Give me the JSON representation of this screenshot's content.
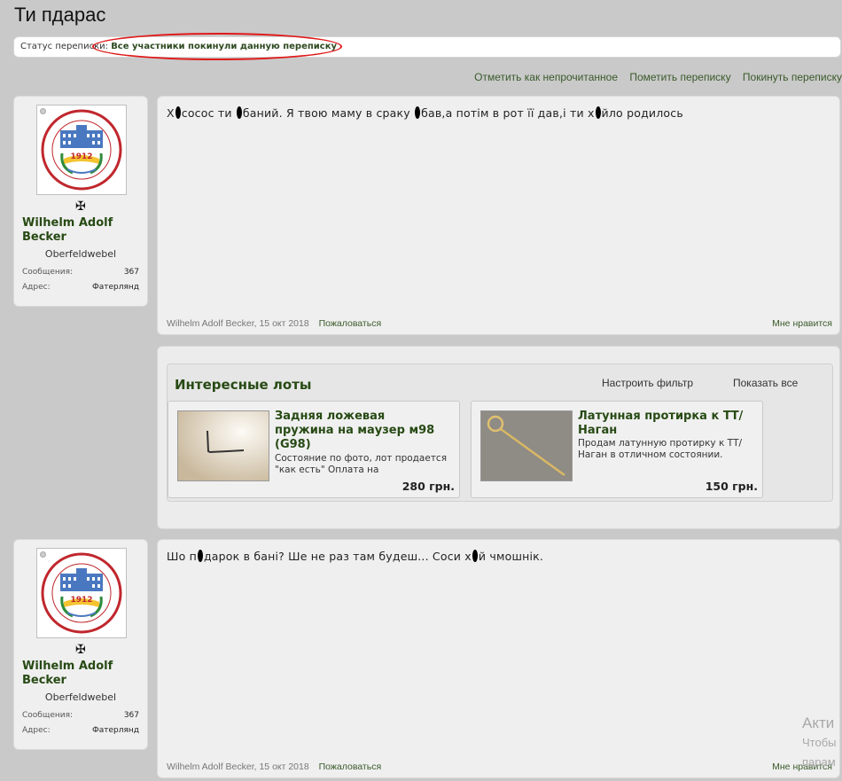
{
  "page": {
    "title": "Ти п◖дарас"
  },
  "status": {
    "label": "Статус переписки:",
    "value": "Все участники покинули данную переписку"
  },
  "conversation_actions": [
    "Отметить как непрочитанное",
    "Пометить переписку",
    "Покинуть переписку"
  ],
  "posts": [
    {
      "user": {
        "name": "Wilhelm Adolf Becker",
        "rank": "Oberfeldwebel",
        "rank_icon": "✠",
        "stats": [
          {
            "label": "Сообщения:",
            "value": "367"
          },
          {
            "label": "Адрес:",
            "value": "Фатерлянд"
          }
        ]
      },
      "text": "Х◖сосос ти ◖баний. Я твою маму в сраку ◖бав,а потім в рот її дав,і ти х◖йло родилось",
      "author": "Wilhelm Adolf Becker",
      "date": "15 окт 2018",
      "report": "Пожаловаться",
      "like": "Мне нравится"
    },
    {
      "user": {
        "name": "Wilhelm Adolf Becker",
        "rank": "Oberfeldwebel",
        "rank_icon": "✠",
        "stats": [
          {
            "label": "Сообщения:",
            "value": "367"
          },
          {
            "label": "Адрес:",
            "value": "Фатерлянд"
          }
        ]
      },
      "text": "Шо п◖дарок в бані? Ше не раз там будеш... Соси х◖й чмошнік.",
      "author": "Wilhelm Adolf Becker",
      "date": "15 окт 2018",
      "report": "Пожаловаться",
      "like": "Мне нравится"
    }
  ],
  "lots": {
    "title": "Интересные лоты",
    "actions": [
      "Настроить фильтр",
      "Показать все"
    ],
    "items": [
      {
        "title": "Задняя ложевая пружина на маузер м98 (G98)",
        "desc": "Состояние по фото, лот продается \"как есть\" Оплата на",
        "price": "280 грн."
      },
      {
        "title": "Латунная протирка к ТТ/Наган",
        "desc": "Продам латунную протирку к ТТ/Наган в отличном состоянии.",
        "price": "150 грн."
      }
    ]
  },
  "logo": {
    "year": "1912"
  },
  "watermark": {
    "line1": "Акти",
    "line2": "Чтобы",
    "line3": "парам"
  }
}
